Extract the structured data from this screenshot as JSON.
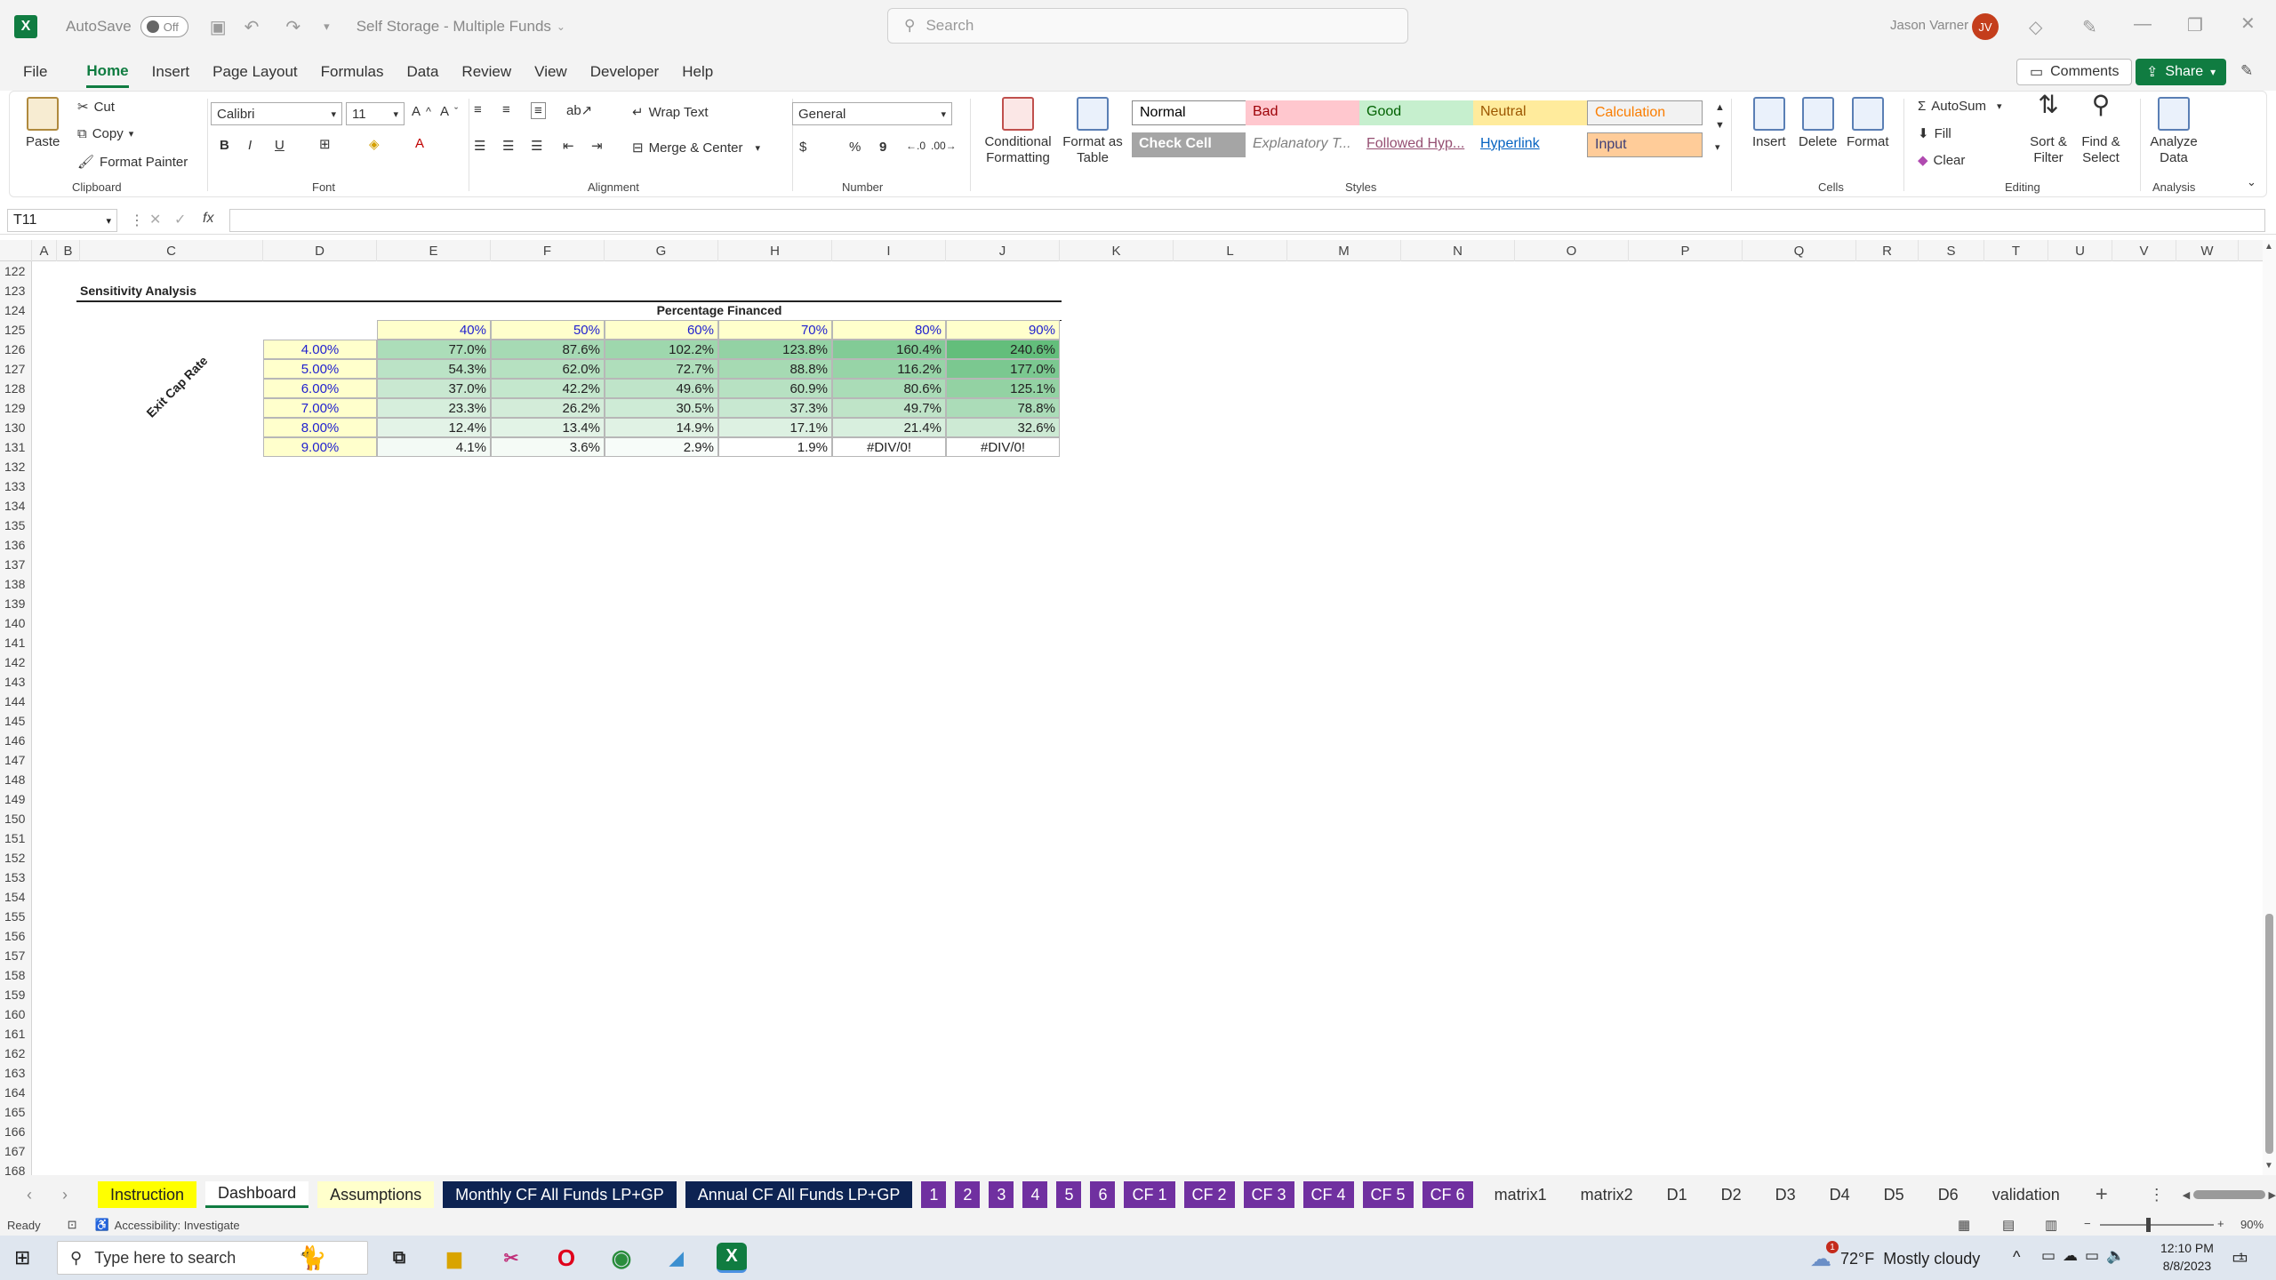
{
  "titlebar": {
    "logo": "X",
    "autosave_label": "AutoSave",
    "autosave_state": "Off",
    "doc_title": "Self Storage - Multiple Funds",
    "search_placeholder": "Search",
    "user_name": "Jason Varner",
    "user_initials": "JV"
  },
  "menu": {
    "items": [
      "File",
      "Home",
      "Insert",
      "Page Layout",
      "Formulas",
      "Data",
      "Review",
      "View",
      "Developer",
      "Help"
    ],
    "active": "Home",
    "comments_label": "Comments",
    "share_label": "Share"
  },
  "ribbon": {
    "clipboard": {
      "paste": "Paste",
      "cut": "Cut",
      "copy": "Copy",
      "format_painter": "Format Painter",
      "label": "Clipboard"
    },
    "font": {
      "name": "Calibri",
      "size": "11",
      "bold": "B",
      "italic": "I",
      "underline": "U",
      "label": "Font"
    },
    "alignment": {
      "wrap": "Wrap Text",
      "merge": "Merge & Center",
      "label": "Alignment"
    },
    "number": {
      "format": "General",
      "currency": "$",
      "percent": "%",
      "comma": "9",
      "label": "Number"
    },
    "styles": {
      "conditional": "Conditional Formatting",
      "format_table": "Format as Table",
      "cells": [
        {
          "text": "Normal",
          "bg": "#ffffff",
          "color": "#000000"
        },
        {
          "text": "Bad",
          "bg": "#ffc7ce",
          "color": "#9c0006"
        },
        {
          "text": "Good",
          "bg": "#c6efce",
          "color": "#006100"
        },
        {
          "text": "Neutral",
          "bg": "#ffeb9c",
          "color": "#9c5700"
        },
        {
          "text": "Calculation",
          "bg": "#f2f2f2",
          "color": "#fa7d00"
        },
        {
          "text": "Check Cell",
          "bg": "#a5a5a5",
          "color": "#ffffff"
        },
        {
          "text": "Explanatory T...",
          "bg": "#ffffff",
          "color": "#7f7f7f"
        },
        {
          "text": "Followed Hyp...",
          "bg": "#ffffff",
          "color": "#954f72"
        },
        {
          "text": "Hyperlink",
          "bg": "#ffffff",
          "color": "#0563c1"
        },
        {
          "text": "Input",
          "bg": "#ffcc99",
          "color": "#3f3f76"
        }
      ],
      "label": "Styles"
    },
    "cells": {
      "insert": "Insert",
      "delete": "Delete",
      "format": "Format",
      "label": "Cells"
    },
    "editing": {
      "autosum": "AutoSum",
      "fill": "Fill",
      "clear": "Clear",
      "sort": "Sort & Filter",
      "find": "Find & Select",
      "label": "Editing"
    },
    "analysis": {
      "analyze": "Analyze Data",
      "label": "Analysis"
    }
  },
  "formula": {
    "namebox": "T11",
    "fx": "fx",
    "value": ""
  },
  "columns": [
    "A",
    "B",
    "C",
    "D",
    "E",
    "F",
    "G",
    "H",
    "I",
    "J",
    "K",
    "L",
    "M",
    "N",
    "O",
    "P",
    "Q",
    "R",
    "S",
    "T",
    "U",
    "V",
    "W"
  ],
  "rows": [
    "122",
    "123",
    "124",
    "125",
    "126",
    "127",
    "128",
    "129",
    "130",
    "131",
    "132",
    "133",
    "134",
    "135",
    "136",
    "137",
    "138",
    "139",
    "140",
    "141",
    "142",
    "143",
    "144",
    "145",
    "146",
    "147",
    "148",
    "149",
    "150",
    "151",
    "152",
    "153",
    "154",
    "155",
    "156",
    "157",
    "158",
    "159",
    "160",
    "161",
    "162",
    "163",
    "164",
    "165",
    "166",
    "167",
    "168"
  ],
  "sheet": {
    "section_title": "Sensitivity Analysis",
    "header": "Percentage Financed",
    "axis_label": "Exit Cap Rate",
    "col_values": [
      "40%",
      "50%",
      "60%",
      "70%",
      "80%",
      "90%"
    ],
    "row_values": [
      "4.00%",
      "5.00%",
      "6.00%",
      "7.00%",
      "8.00%",
      "9.00%"
    ],
    "matrix": [
      [
        "77.0%",
        "87.6%",
        "102.2%",
        "123.8%",
        "160.4%",
        "240.6%"
      ],
      [
        "54.3%",
        "62.0%",
        "72.7%",
        "88.8%",
        "116.2%",
        "177.0%"
      ],
      [
        "37.0%",
        "42.2%",
        "49.6%",
        "60.9%",
        "80.6%",
        "125.1%"
      ],
      [
        "23.3%",
        "26.2%",
        "30.5%",
        "37.3%",
        "49.7%",
        "78.8%"
      ],
      [
        "12.4%",
        "13.4%",
        "14.9%",
        "17.1%",
        "21.4%",
        "32.6%"
      ],
      [
        "4.1%",
        "3.6%",
        "2.9%",
        "1.9%",
        "#DIV/0!",
        "#DIV/0!"
      ]
    ]
  },
  "tabs": [
    {
      "label": "Instruction",
      "style": "yellowtab"
    },
    {
      "label": "Dashboard",
      "style": "active"
    },
    {
      "label": "Assumptions",
      "style": "yellowlight"
    },
    {
      "label": "Monthly CF All Funds LP+GP",
      "style": "navy"
    },
    {
      "label": "Annual CF All Funds LP+GP",
      "style": "navy"
    },
    {
      "label": "1",
      "style": "purple"
    },
    {
      "label": "2",
      "style": "purple"
    },
    {
      "label": "3",
      "style": "purple"
    },
    {
      "label": "4",
      "style": "purple"
    },
    {
      "label": "5",
      "style": "purple"
    },
    {
      "label": "6",
      "style": "purple"
    },
    {
      "label": "CF 1",
      "style": "purple"
    },
    {
      "label": "CF 2",
      "style": "purple"
    },
    {
      "label": "CF 3",
      "style": "purple"
    },
    {
      "label": "CF 4",
      "style": "purple"
    },
    {
      "label": "CF 5",
      "style": "purple"
    },
    {
      "label": "CF 6",
      "style": "purple"
    },
    {
      "label": "matrix1",
      "style": "plain"
    },
    {
      "label": "matrix2",
      "style": "plain"
    },
    {
      "label": "D1",
      "style": "plain"
    },
    {
      "label": "D2",
      "style": "plain"
    },
    {
      "label": "D3",
      "style": "plain"
    },
    {
      "label": "D4",
      "style": "plain"
    },
    {
      "label": "D5",
      "style": "plain"
    },
    {
      "label": "D6",
      "style": "plain"
    },
    {
      "label": "validation",
      "style": "plain"
    }
  ],
  "status": {
    "ready": "Ready",
    "accessibility": "Accessibility: Investigate",
    "zoom": "90%"
  },
  "taskbar": {
    "search_placeholder": "Type here to search",
    "weather_temp": "72°F",
    "weather_desc": "Mostly cloudy",
    "time": "12:10 PM",
    "date": "8/8/2023",
    "notif_count": "1",
    "weather_badge": "1"
  },
  "colors": {
    "excel_green": "#107c41",
    "purple_tab": "#7030a0",
    "navy_tab": "#0d2352",
    "heat_high": "#63be7b",
    "heat_low": "#ffffff"
  }
}
